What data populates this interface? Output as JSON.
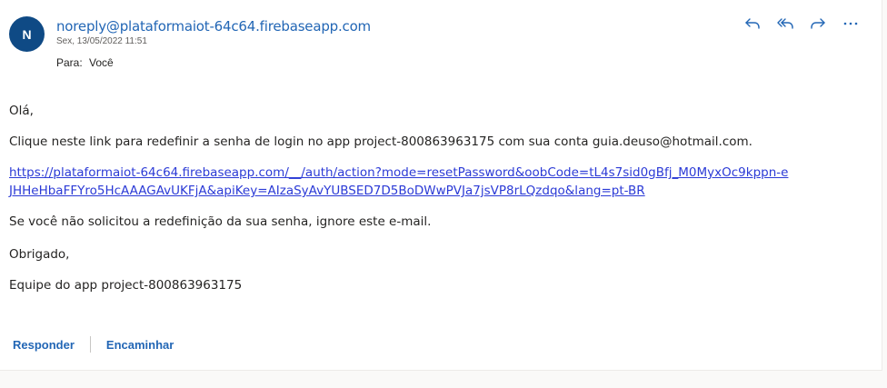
{
  "email": {
    "avatar_initial": "N",
    "sender": "noreply@plataformaiot-64c64.firebaseapp.com",
    "date": "Sex, 13/05/2022 11:51",
    "to_label": "Para:",
    "to_value": "Você"
  },
  "actions": {
    "reply_icon": "reply-icon",
    "reply_all_icon": "reply-all-icon",
    "forward_icon": "forward-icon",
    "more_icon": "more-icon"
  },
  "body": {
    "greeting": "Olá,",
    "click_text": "Clique neste link para redefinir a senha de login no app project-800863963175 com sua conta guia.deuso@hotmail.com.",
    "link": "https://plataformaiot-64c64.firebaseapp.com/__/auth/action?mode=resetPassword&oobCode=tL4s7sid0gBfj_M0MyxOc9kppn-eJHHeHbaFFYro5HcAAAGAvUKFjA&apiKey=AIzaSyAvYUBSED7D5BoDWwPVJa7jsVP8rLQzdqo&lang=pt-BR",
    "ignore_text": "Se você não solicitou a redefinição da sua senha, ignore este e-mail.",
    "thanks": "Obrigado,",
    "team": "Equipe do app project-800863963175"
  },
  "footer": {
    "reply_label": "Responder",
    "forward_label": "Encaminhar"
  },
  "colors": {
    "accent": "#2266b5",
    "avatar_bg": "#0f4a85",
    "link": "#2b3ad6"
  }
}
